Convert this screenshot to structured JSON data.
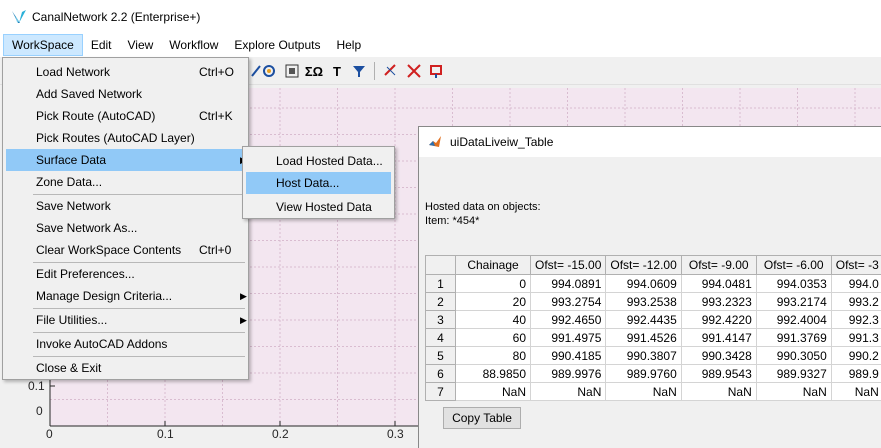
{
  "app": {
    "title": "CanalNetwork 2.2  (Enterprise+)"
  },
  "menubar": {
    "items": [
      {
        "label": "WorkSpace"
      },
      {
        "label": "Edit"
      },
      {
        "label": "View"
      },
      {
        "label": "Workflow"
      },
      {
        "label": "Explore Outputs"
      },
      {
        "label": "Help"
      }
    ]
  },
  "workspace_menu": {
    "load_network": {
      "label": "Load Network",
      "shortcut": "Ctrl+O"
    },
    "add_saved_network": {
      "label": "Add Saved Network"
    },
    "pick_route": {
      "label": "Pick Route (AutoCAD)",
      "shortcut": "Ctrl+K"
    },
    "pick_routes_layer": {
      "label": "Pick Routes (AutoCAD Layer)"
    },
    "surface_data": {
      "label": "Surface Data"
    },
    "zone_data": {
      "label": "Zone Data..."
    },
    "save_network": {
      "label": "Save Network"
    },
    "save_network_as": {
      "label": "Save Network As..."
    },
    "clear_workspace": {
      "label": "Clear WorkSpace Contents",
      "shortcut": "Ctrl+0"
    },
    "edit_preferences": {
      "label": "Edit Preferences..."
    },
    "manage_design_criteria": {
      "label": "Manage Design Criteria..."
    },
    "file_utilities": {
      "label": "File Utilities..."
    },
    "invoke_autocad_addons": {
      "label": "Invoke AutoCAD Addons"
    },
    "close_exit": {
      "label": "Close & Exit"
    }
  },
  "surface_submenu": {
    "load_hosted": {
      "label": "Load Hosted Data..."
    },
    "host_data": {
      "label": "Host Data..."
    },
    "view_hosted": {
      "label": "View Hosted Data"
    }
  },
  "axes": {
    "y_ticks": [
      "0.1",
      "0"
    ],
    "x_ticks": [
      "0",
      "0.1",
      "0.2",
      "0.3"
    ]
  },
  "data_window": {
    "title": "uiDataLiveiw_Table",
    "info_line1": "Hosted data on objects:",
    "info_line2": "Item: *454*",
    "copy_button": "Copy Table",
    "table": {
      "headers": [
        "",
        "Chainage",
        "Ofst= -15.00",
        "Ofst= -12.00",
        "Ofst= -9.00",
        "Ofst= -6.00",
        "Ofst= -3"
      ],
      "rows": [
        [
          "1",
          "0",
          "994.0891",
          "994.0609",
          "994.0481",
          "994.0353",
          "994.0"
        ],
        [
          "2",
          "20",
          "993.2754",
          "993.2538",
          "993.2323",
          "993.2174",
          "993.2"
        ],
        [
          "3",
          "40",
          "992.4650",
          "992.4435",
          "992.4220",
          "992.4004",
          "992.3"
        ],
        [
          "4",
          "60",
          "991.4975",
          "991.4526",
          "991.4147",
          "991.3769",
          "991.3"
        ],
        [
          "5",
          "80",
          "990.4185",
          "990.3807",
          "990.3428",
          "990.3050",
          "990.2"
        ],
        [
          "6",
          "88.9850",
          "989.9976",
          "989.9760",
          "989.9543",
          "989.9327",
          "989.9"
        ],
        [
          "7",
          "NaN",
          "NaN",
          "NaN",
          "NaN",
          "NaN",
          "NaN"
        ]
      ]
    }
  },
  "colors": {
    "highlight": "#91c9f7",
    "plot_bg": "#f3e6f0",
    "grid": "#d9bcd0"
  }
}
